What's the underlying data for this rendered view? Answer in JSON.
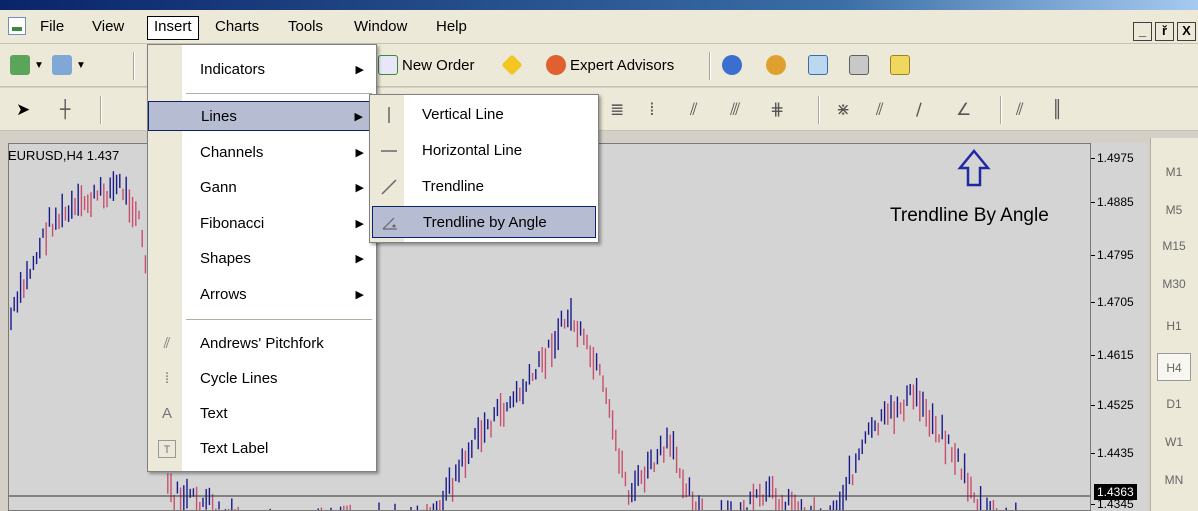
{
  "menubar": {
    "items": [
      "File",
      "View",
      "Insert",
      "Charts",
      "Tools",
      "Window",
      "Help"
    ],
    "window_controls": [
      "_",
      "ř",
      "X"
    ]
  },
  "toolbar": {
    "new_order": "New Order",
    "expert_advisors": "Expert Advisors"
  },
  "insert_menu": {
    "items": [
      {
        "label": "Indicators",
        "submenu": true
      },
      {
        "label": "Lines",
        "submenu": true
      },
      {
        "label": "Channels",
        "submenu": true
      },
      {
        "label": "Gann",
        "submenu": true
      },
      {
        "label": "Fibonacci",
        "submenu": true
      },
      {
        "label": "Shapes",
        "submenu": true
      },
      {
        "label": "Arrows",
        "submenu": true
      },
      {
        "label": "Andrews' Pitchfork",
        "icon": "pitchfork-icon"
      },
      {
        "label": "Cycle Lines",
        "icon": "cycle-lines-icon"
      },
      {
        "label": "Text",
        "icon": "text-icon"
      },
      {
        "label": "Text Label",
        "icon": "text-label-icon"
      }
    ],
    "highlighted": "Lines"
  },
  "lines_menu": {
    "items": [
      {
        "label": "Vertical Line",
        "icon": "vertical-line-icon"
      },
      {
        "label": "Horizontal Line",
        "icon": "horizontal-line-icon"
      },
      {
        "label": "Trendline",
        "icon": "trendline-icon"
      },
      {
        "label": "Trendline by Angle",
        "icon": "trendline-angle-icon"
      }
    ],
    "highlighted": "Trendline by Angle"
  },
  "chart": {
    "symbol_label": "EURUSD,H4  1.437",
    "annotation": "Trendline By Angle",
    "price_levels": [
      "1.4975",
      "1.4885",
      "1.4795",
      "1.4705",
      "1.4615",
      "1.4525",
      "1.4435",
      "1.4345"
    ],
    "current_price": "1.4363",
    "colors": {
      "bull": "#1a1a8c",
      "bear": "#c8506e",
      "background": "#d4d4d4"
    }
  },
  "timeframes": {
    "items": [
      "M1",
      "M5",
      "M15",
      "M30",
      "H1",
      "H4",
      "D1",
      "W1",
      "MN"
    ],
    "selected": "H4"
  }
}
